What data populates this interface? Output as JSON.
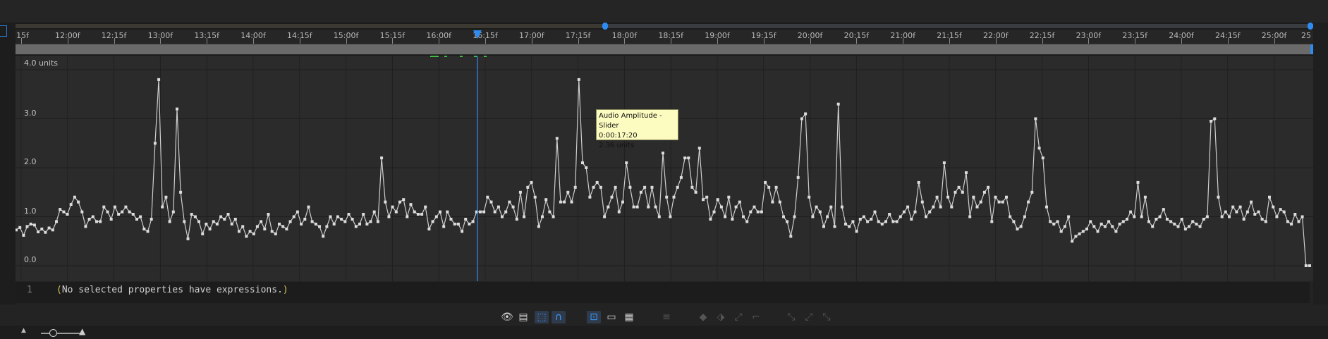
{
  "ruler": {
    "labels": [
      "15f",
      "12:00f",
      "12:15f",
      "13:00f",
      "13:15f",
      "14:00f",
      "14:15f",
      "15:00f",
      "15:15f",
      "16:00f",
      "16:15f",
      "17:00f",
      "17:15f",
      "18:00f",
      "18:15f",
      "19:00f",
      "19:15f",
      "20:00f",
      "20:15f",
      "21:00f",
      "21:15f",
      "22:00f",
      "22:15f",
      "23:00f",
      "23:15f",
      "24:00f",
      "24:15f",
      "25:00f",
      "25"
    ]
  },
  "graph": {
    "unit_label": "4.0 units",
    "y_labels": [
      "3.0",
      "2.0",
      "1.0",
      "0.0"
    ],
    "playhead_color": "#2d8cf0",
    "curve_color": "#cfcfcf"
  },
  "tooltip": {
    "title": "Audio Amplitude - Slider",
    "time": "0:00:17:20",
    "value": "2.36 units"
  },
  "chart_data": {
    "type": "line",
    "y_unit": "units",
    "ylim": [
      0,
      4
    ],
    "x_start": "0:00:11:15",
    "x_end": "0:00:25:15",
    "values": [
      0.73,
      0.78,
      0.62,
      0.8,
      0.85,
      0.83,
      0.69,
      0.75,
      0.68,
      0.77,
      0.73,
      0.9,
      1.15,
      1.1,
      1.05,
      1.25,
      1.4,
      1.3,
      1.1,
      0.8,
      0.95,
      1.0,
      0.9,
      0.9,
      1.2,
      1.1,
      0.95,
      1.2,
      1.05,
      1.1,
      1.2,
      1.1,
      1.05,
      0.95,
      1.0,
      0.75,
      0.7,
      0.95,
      2.5,
      3.8,
      1.2,
      1.4,
      0.9,
      1.1,
      3.2,
      1.5,
      0.9,
      0.55,
      1.05,
      1.0,
      0.9,
      0.65,
      0.85,
      0.75,
      0.9,
      0.85,
      1.0,
      0.95,
      1.05,
      0.85,
      0.95,
      0.7,
      0.8,
      0.6,
      0.7,
      0.65,
      0.8,
      0.9,
      0.75,
      1.05,
      0.7,
      0.65,
      0.85,
      0.8,
      0.75,
      0.9,
      1.0,
      1.1,
      0.85,
      0.95,
      1.2,
      0.9,
      0.85,
      0.8,
      0.6,
      0.8,
      1.0,
      0.85,
      1.0,
      0.95,
      0.9,
      1.05,
      0.95,
      0.8,
      0.85,
      1.05,
      0.85,
      0.9,
      1.1,
      0.9,
      2.2,
      1.3,
      1.0,
      1.2,
      1.1,
      1.3,
      1.35,
      1.0,
      1.25,
      1.1,
      1.05,
      1.05,
      1.2,
      0.75,
      0.9,
      1.0,
      1.1,
      0.8,
      1.1,
      0.95,
      0.85,
      0.85,
      0.7,
      0.95,
      0.85,
      0.9,
      1.1,
      1.1,
      1.1,
      1.4,
      1.3,
      1.1,
      1.2,
      1.0,
      1.1,
      1.3,
      1.2,
      0.95,
      1.5,
      1.0,
      1.6,
      1.7,
      1.4,
      0.8,
      1.0,
      1.35,
      1.1,
      1.0,
      2.6,
      1.3,
      1.3,
      1.5,
      1.3,
      1.6,
      3.8,
      2.1,
      2.0,
      1.4,
      1.6,
      1.7,
      1.6,
      1.0,
      1.2,
      1.4,
      1.6,
      1.1,
      1.3,
      2.1,
      1.6,
      1.2,
      1.2,
      1.5,
      1.6,
      1.2,
      1.6,
      1.2,
      1.0,
      2.3,
      1.4,
      1.0,
      1.4,
      1.6,
      1.8,
      2.2,
      2.2,
      1.6,
      1.5,
      2.4,
      1.35,
      1.4,
      0.95,
      1.1,
      1.35,
      1.2,
      1.0,
      1.4,
      0.95,
      1.2,
      1.3,
      1.0,
      0.9,
      1.1,
      1.2,
      1.1,
      1.1,
      1.7,
      1.6,
      1.3,
      1.6,
      1.3,
      1.0,
      0.9,
      0.6,
      1.0,
      1.8,
      3.0,
      3.1,
      1.4,
      1.0,
      1.2,
      1.1,
      0.8,
      1.0,
      1.2,
      0.8,
      3.3,
      1.2,
      0.85,
      0.8,
      0.9,
      0.7,
      0.95,
      1.0,
      0.9,
      0.95,
      1.1,
      0.9,
      0.85,
      0.9,
      1.05,
      0.9,
      0.9,
      1.0,
      1.1,
      1.2,
      0.95,
      1.1,
      1.7,
      1.3,
      1.0,
      1.1,
      1.2,
      1.4,
      1.2,
      2.1,
      1.4,
      1.2,
      1.5,
      1.6,
      1.5,
      1.9,
      1.0,
      1.4,
      1.2,
      1.3,
      1.5,
      1.6,
      0.9,
      1.4,
      1.3,
      1.3,
      1.4,
      1.0,
      0.9,
      0.75,
      0.8,
      1.0,
      1.3,
      1.5,
      3.0,
      2.4,
      2.2,
      1.2,
      0.9,
      0.85,
      0.9,
      0.7,
      0.8,
      1.0,
      0.5,
      0.6,
      0.65,
      0.7,
      0.75,
      0.9,
      0.8,
      0.7,
      0.85,
      0.8,
      0.9,
      0.8,
      0.7,
      0.85,
      0.9,
      0.95,
      1.1,
      1.0,
      1.7,
      1.0,
      1.4,
      0.9,
      0.8,
      0.95,
      1.0,
      1.15,
      0.95,
      0.9,
      0.85,
      0.8,
      0.95,
      0.75,
      0.8,
      0.9,
      0.85,
      0.8,
      0.95,
      1.0,
      2.95,
      3.0,
      1.4,
      1.0,
      1.1,
      1.0,
      1.2,
      1.1,
      1.2,
      0.95,
      1.1,
      1.3,
      1.05,
      1.1,
      0.95,
      0.9,
      1.4,
      1.2,
      1.0,
      1.15,
      1.1,
      0.9,
      0.85,
      1.05,
      0.9,
      1.0,
      0.0,
      0.0
    ]
  },
  "expression": {
    "line_number": "1",
    "text": "No selected properties have expressions.",
    "open_paren": "(",
    "close_paren": ")"
  },
  "toolbar": {
    "buttons": [
      {
        "name": "show-properties-icon",
        "glyph": "👁",
        "state": "normal"
      },
      {
        "name": "graph-options-icon",
        "glyph": "▤",
        "state": "normal"
      },
      {
        "name": "transform-box-icon",
        "glyph": "⬚",
        "state": "on"
      },
      {
        "name": "snap-icon",
        "glyph": "∩",
        "state": "on"
      },
      {
        "name": "fit-selection-icon",
        "glyph": "⊡",
        "state": "on"
      },
      {
        "name": "fit-all-icon",
        "glyph": "▭",
        "state": "normal"
      },
      {
        "name": "separate-dimensions-icon",
        "glyph": "▦",
        "state": "normal"
      },
      {
        "name": "edit-keyframe-icon",
        "glyph": "≡",
        "state": "dim"
      },
      {
        "name": "hold-keyframe-icon",
        "glyph": "◆",
        "state": "dim"
      },
      {
        "name": "linear-keyframe-icon",
        "glyph": "⬗",
        "state": "dim"
      },
      {
        "name": "auto-bezier-icon",
        "glyph": "⤢",
        "state": "dim"
      },
      {
        "name": "easy-ease-icon",
        "glyph": "⌐",
        "state": "dim"
      },
      {
        "name": "easy-ease-in-icon",
        "glyph": "⤡",
        "state": "dim"
      },
      {
        "name": "easy-ease-out-icon",
        "glyph": "⤢",
        "state": "dim"
      },
      {
        "name": "easy-ease-both-icon",
        "glyph": "⤡",
        "state": "dim"
      }
    ]
  }
}
